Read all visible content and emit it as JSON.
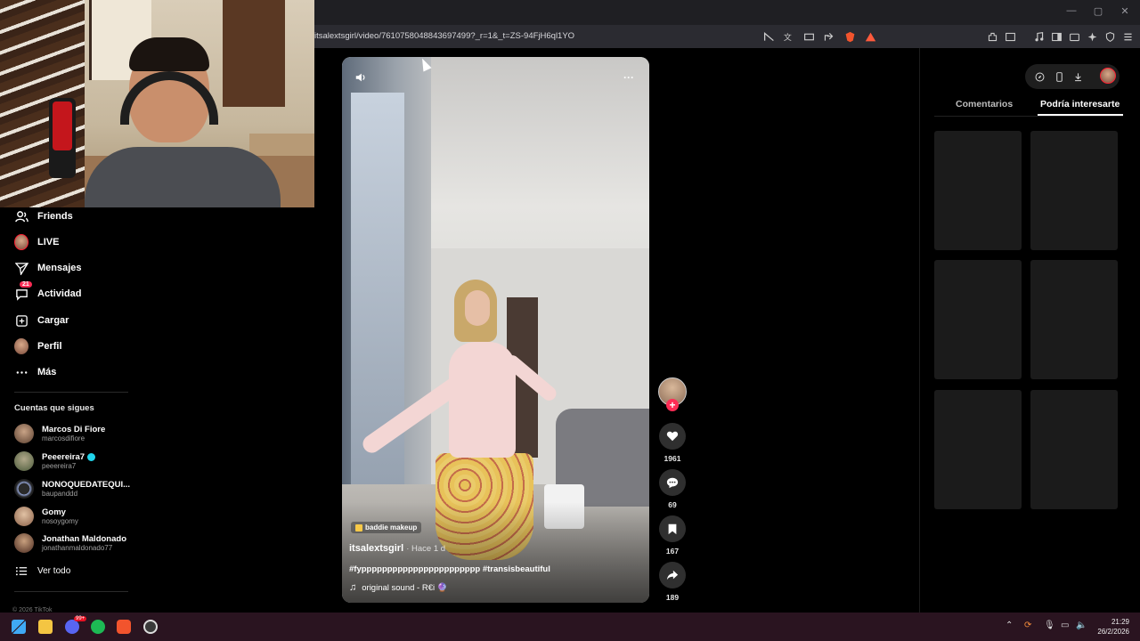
{
  "browser": {
    "url": "itsalextsgirl/video/7610758048843697499?_r=1&_t=ZS-94FjH6ql1YO",
    "window_controls": [
      "—",
      "▢",
      "✕"
    ]
  },
  "sidebar": {
    "items": [
      {
        "label": "Friends",
        "icon": "friends-icon"
      },
      {
        "label": "LIVE",
        "icon": "live-icon"
      },
      {
        "label": "Mensajes",
        "icon": "messages-icon"
      },
      {
        "label": "Actividad",
        "icon": "activity-icon",
        "badge": "21"
      },
      {
        "label": "Cargar",
        "icon": "upload-icon"
      },
      {
        "label": "Perfil",
        "icon": "profile-icon"
      },
      {
        "label": "Más",
        "icon": "more-icon"
      }
    ],
    "following_title": "Cuentas que sigues",
    "following": [
      {
        "name": "Marcos Di Fiore",
        "handle": "marcosdifiore",
        "verified": false
      },
      {
        "name": "Peeereira7",
        "handle": "peeereira7",
        "verified": true
      },
      {
        "name": "NONOQUEDATEQUI...",
        "handle": "baupanddd",
        "verified": false
      },
      {
        "name": "Gomy",
        "handle": "nosoygomy",
        "verified": false
      },
      {
        "name": "Jonathan Maldonado",
        "handle": "jonathanmaldonado77",
        "verified": false
      }
    ],
    "see_all": "Ver todo",
    "copyright": "© 2026 TikTok"
  },
  "video": {
    "tag": "baddie makeup",
    "author": "itsalextsgirl",
    "time_ago": "· Hace 1 d",
    "caption": "#fyppppppppppppppppppppppp #transisbeautiful",
    "sound": "original sound - R€i 🔮",
    "more_label": "···"
  },
  "actions": {
    "likes": "1961",
    "comments": "69",
    "saves": "167",
    "shares": "189"
  },
  "right_panel": {
    "tabs": [
      "Comentarios",
      "Podría interesarte"
    ],
    "active_tab": 1
  },
  "taskbar": {
    "discord_badge": "99+",
    "time": "21:29",
    "date": "26/2/2026"
  }
}
